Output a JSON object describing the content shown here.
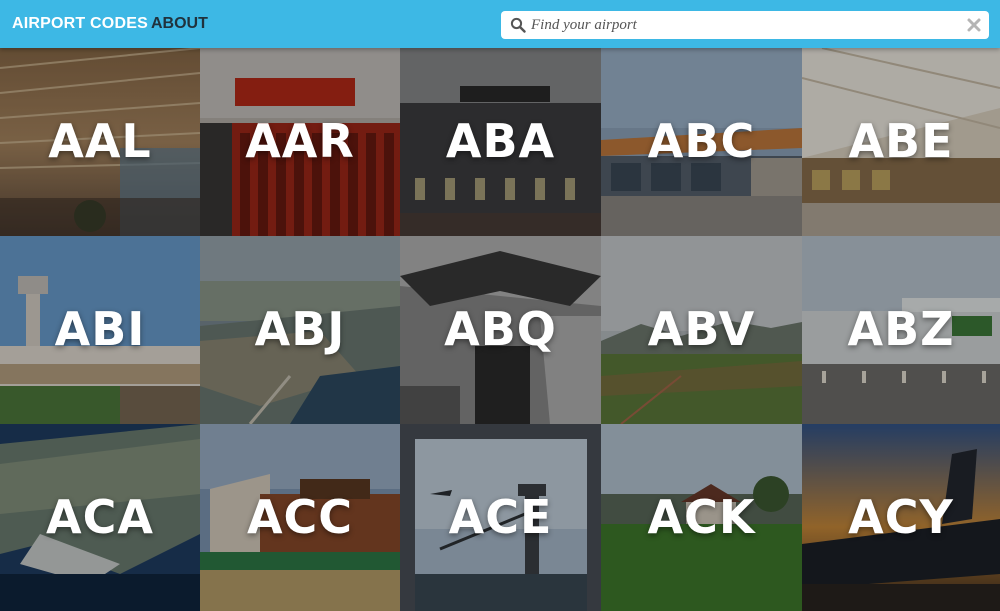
{
  "header": {
    "brand": "AIRPORT CODES",
    "nav": [
      {
        "label": "ABOUT"
      }
    ],
    "search": {
      "placeholder": "Find your airport",
      "value": "",
      "icon": "search-icon",
      "clear_icon": "close-icon"
    },
    "bg_color": "#3db8e5"
  },
  "airports": [
    {
      "code": "AAL",
      "photo": "airport-terminal-roof-interior"
    },
    {
      "code": "AAR",
      "photo": "aarhus-terminal-sign"
    },
    {
      "code": "ABA",
      "photo": "abakan-terminal-facade"
    },
    {
      "code": "ABC",
      "photo": "modern-terminal-exterior"
    },
    {
      "code": "ABE",
      "photo": "terminal-concourse-interior"
    },
    {
      "code": "ABI",
      "photo": "control-tower-and-terminal"
    },
    {
      "code": "ABJ",
      "photo": "aerial-city-lagoon"
    },
    {
      "code": "ABQ",
      "photo": "eagle-sculpture"
    },
    {
      "code": "ABV",
      "photo": "hills-landscape"
    },
    {
      "code": "ABZ",
      "photo": "aberdeen-terminal"
    },
    {
      "code": "ACA",
      "photo": "aerial-coastline"
    },
    {
      "code": "ACC",
      "photo": "modern-building-exterior"
    },
    {
      "code": "ACE",
      "photo": "control-tower-plane-landing"
    },
    {
      "code": "ACK",
      "photo": "grass-field-houses"
    },
    {
      "code": "ACY",
      "photo": "fighter-jet-sunset"
    }
  ]
}
